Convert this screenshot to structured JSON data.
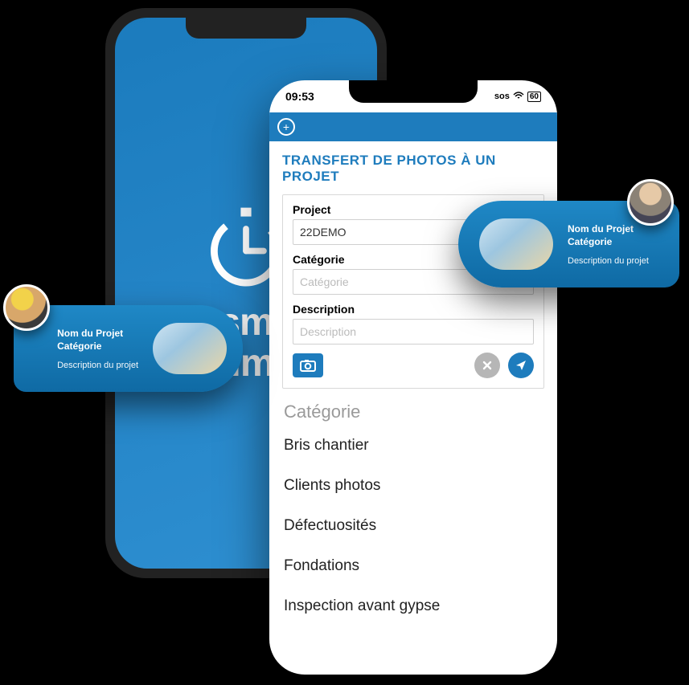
{
  "splash": {
    "brand_line1": "sm",
    "brand_line2": "tim"
  },
  "statusbar": {
    "time": "09:53",
    "sos": "sos",
    "battery": "60"
  },
  "screen": {
    "title": "TRANSFERT DE PHOTOS À UN PROJET",
    "fields": {
      "project": {
        "label": "Project",
        "value": "22DEMO"
      },
      "category": {
        "label": "Catégorie",
        "placeholder": "Catégorie"
      },
      "description": {
        "label": "Description",
        "placeholder": "Description"
      }
    },
    "category_header": "Catégorie",
    "categories": [
      "Bris chantier",
      "Clients photos",
      "Défectuosités",
      "Fondations",
      "Inspection avant gypse"
    ]
  },
  "callouts": {
    "left": {
      "line1": "Nom du Projet",
      "line2": "Catégorie",
      "desc": "Description du projet"
    },
    "right": {
      "line1": "Nom du Projet",
      "line2": "Catégorie",
      "desc": "Description du projet"
    }
  }
}
